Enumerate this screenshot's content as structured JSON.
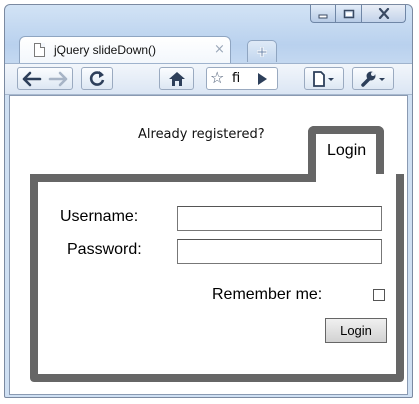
{
  "browser": {
    "tab_title": "jQuery slideDown()",
    "address_text": "fi",
    "accent_color": "#b9d1ee"
  },
  "page": {
    "already_registered": "Already registered?",
    "login_tab_label": "Login",
    "username_label": "Username:",
    "username_value": "",
    "password_label": "Password:",
    "password_value": "",
    "remember_label": "Remember me:",
    "login_button": "Login",
    "panel_border_color": "#666666"
  }
}
